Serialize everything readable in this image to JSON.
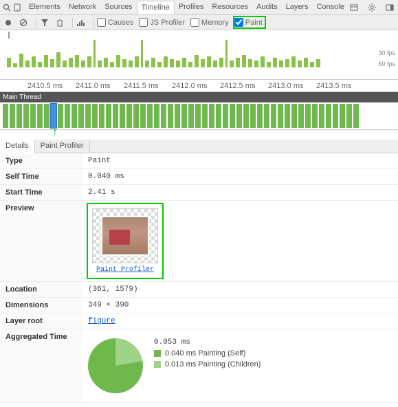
{
  "panels": [
    "Elements",
    "Network",
    "Sources",
    "Timeline",
    "Profiles",
    "Resources",
    "Audits",
    "Layers",
    "Console"
  ],
  "activePanel": "Timeline",
  "toolbar": {
    "checkboxes": {
      "causes": "Causes",
      "jsProfiler": "JS Profiler",
      "memory": "Memory",
      "paint": "Paint"
    }
  },
  "fps": {
    "line1": "30 fps",
    "line2": "60 fps"
  },
  "ruler": [
    "2410.5 ms",
    "2411.0 ms",
    "2411.5 ms",
    "2412.0 ms",
    "2412.5 ms",
    "2413.0 ms",
    "2413.5 ms"
  ],
  "mainThreadLabel": "Main Thread",
  "subTabs": {
    "details": "Details",
    "paintProfiler": "Paint Profiler"
  },
  "details": {
    "typeLabel": "Type",
    "typeValue": "Paint",
    "selfTimeLabel": "Self Time",
    "selfTimeValue": "0.040 ms",
    "startTimeLabel": "Start Time",
    "startTimeValue": "2.41 s",
    "previewLabel": "Preview",
    "previewLink": "Paint Profiler",
    "locationLabel": "Location",
    "locationValue": "(361, 1579)",
    "dimensionsLabel": "Dimensions",
    "dimensionsValue": "349 × 390",
    "layerRootLabel": "Layer root",
    "layerRootValue": "figure",
    "aggTimeLabel": "Aggregated Time",
    "aggTotal": "0.053 ms",
    "aggSelf": "0.040 ms Painting (Self)",
    "aggChildren": "0.013 ms Painting (Children)"
  },
  "colors": {
    "paintSelf": "#6fb84e",
    "paintChildren": "#9fd38a",
    "highlight": "#00cc00"
  }
}
